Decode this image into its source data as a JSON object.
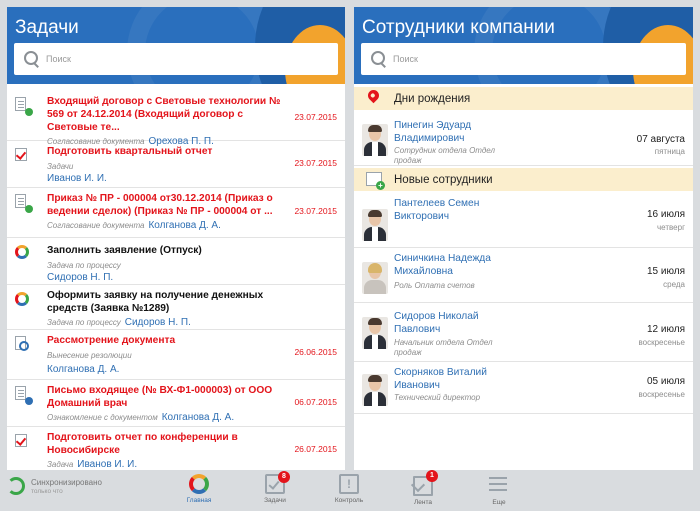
{
  "tasks_panel": {
    "title": "Задачи",
    "search_placeholder": "Поиск",
    "items": [
      {
        "title": "Входящий договор с Световые технологии № 569 от 24.12.2014  (Входящий договор с Световые те...",
        "type": "Согласование документа",
        "person": "Орехова П. П.",
        "date": "23.07.2015",
        "icon": "document-approve-icon",
        "red": true
      },
      {
        "title": "Подготовить квартальный отчет",
        "type": "Задачи",
        "person": "Иванов И. И.",
        "date": "23.07.2015",
        "icon": "task-check-icon",
        "red": true
      },
      {
        "title": "Приказ № ПР - 000004 от30.12.2014 (Приказ о ведении сделок) (Приказ № ПР - 000004 от ...",
        "type": "Согласование документа",
        "person": "Колганова Д. А.",
        "date": "23.07.2015",
        "icon": "document-approve-icon",
        "red": true
      },
      {
        "title": "Заполнить заявление (Отпуск)",
        "type": "Задача по процессу",
        "person": "Сидоров Н. П.",
        "date": "",
        "icon": "process-icon",
        "red": false
      },
      {
        "title": "Оформить заявку на получение денежных средств (Заявка №1289)",
        "type": "Задача по процессу",
        "person": "Сидоров Н. П.",
        "date": "",
        "icon": "process-icon",
        "red": false
      },
      {
        "title": "Рассмотрение документа",
        "type": "Вынесение резолюции",
        "person": "Колганова Д. А.",
        "date": "26.06.2015",
        "icon": "document-review-icon",
        "red": true
      },
      {
        "title": "Письмо входящее (№ ВХ-Ф1-000003) от ООО Домашний врач",
        "type": "Ознакомление с документом",
        "person": "Колганова Д. А.",
        "date": "06.07.2015",
        "icon": "document-read-icon",
        "red": true
      },
      {
        "title": "Подготовить отчет по конференции в Новосибирске",
        "type": "Задача",
        "person": "Иванов И. И.",
        "date": "26.07.2015",
        "icon": "task-check-icon",
        "red": true
      }
    ]
  },
  "employees_panel": {
    "title": "Сотрудники компании",
    "search_placeholder": "Поиск",
    "birthdays_label": "Дни рождения",
    "new_employees_label": "Новые сотрудники",
    "birthdays": [
      {
        "name": "Пинегин Эдуард Владимирович",
        "role": "Сотрудник отдела Отдел продаж",
        "date": "07 августа",
        "day": "пятница"
      }
    ],
    "new_employees": [
      {
        "name": "Пантелеев Семен Викторович",
        "role": "",
        "date": "16 июля",
        "day": "четверг"
      },
      {
        "name": "Синичкина Надежда Михайловна",
        "role": "Роль Оплата счетов",
        "date": "15 июля",
        "day": "среда"
      },
      {
        "name": "Сидоров Николай Павлович",
        "role": "Начальник отдела Отдел продаж",
        "date": "12 июля",
        "day": "воскресенье"
      },
      {
        "name": "Скорняков Виталий Иванович",
        "role": "Технический директор",
        "date": "05 июля",
        "day": "воскресенье"
      }
    ]
  },
  "bottom_bar": {
    "sync_title": "Синхронизировано",
    "sync_sub": "только что",
    "nav": [
      {
        "label": "Главная",
        "icon": "home-icon",
        "badge": ""
      },
      {
        "label": "Задачи",
        "icon": "tasks-icon",
        "badge": "8"
      },
      {
        "label": "Контроль",
        "icon": "control-icon",
        "badge": ""
      },
      {
        "label": "Лента",
        "icon": "feed-icon",
        "badge": "1"
      },
      {
        "label": "Еще",
        "icon": "menu-icon",
        "badge": ""
      }
    ]
  },
  "colors": {
    "header_blue": "#2a6fbd",
    "accent_orange": "#f2a32d",
    "alert_red": "#e3141b",
    "link_blue": "#2f6fb3",
    "section_bg": "#fbeecd"
  }
}
